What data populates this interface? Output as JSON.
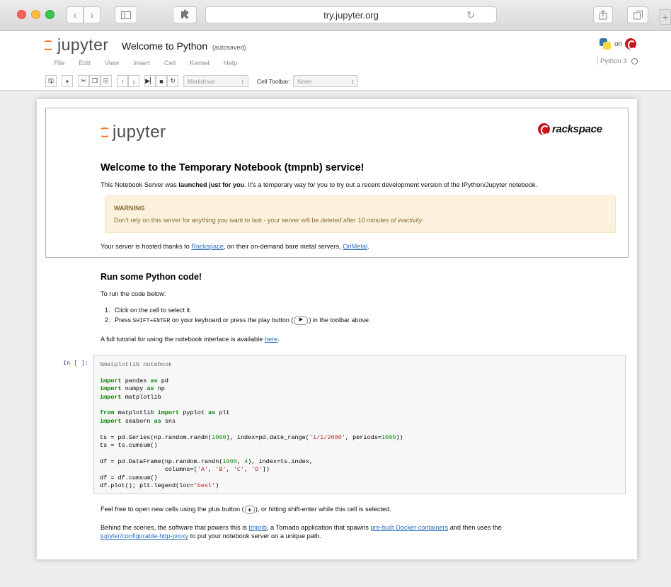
{
  "browser": {
    "url": "try.jupyter.org",
    "back_icon": "chevron-left-icon",
    "forward_icon": "chevron-right-icon",
    "sidebar_icon": "sidebar-icon",
    "extension_icon": "puzzle-icon",
    "reload_icon": "reload-icon",
    "share_icon": "share-icon",
    "tabs_icon": "tabs-icon",
    "plus_tab": "+"
  },
  "jupyter": {
    "logo_text": "jupyter",
    "notebook_title": "Welcome to Python",
    "autosave_status": "(autosaved)",
    "python_on": "on",
    "menu": [
      "File",
      "Edit",
      "View",
      "Insert",
      "Cell",
      "Kernel",
      "Help"
    ],
    "kernel_name": "Python 3",
    "toolbar": {
      "cell_type": "Markdown",
      "cell_toolbar_label": "Cell Toolbar:",
      "cell_toolbar_value": "None"
    }
  },
  "intro_cell": {
    "logo_text": "jupyter",
    "rackspace_text": "rackspace",
    "heading": "Welcome to the Temporary Notebook (tmpnb) service!",
    "p1_before": "This Notebook Server was ",
    "p1_bold": "launched just for you",
    "p1_after": ". It's a temporary way for you to try out a recent development version of the IPython/Jupyter notebook.",
    "warning_title": "WARNING",
    "warning_before": "Don't rely on this server for anything you want to last - your server will be ",
    "warning_em": "deleted after 10 minutes of inactivity",
    "warning_after": ".",
    "host_before": "Your server is hosted thanks to ",
    "host_link1": "Rackspace",
    "host_mid": ", on their on-demand bare metal servers, ",
    "host_link2": "OnMetal",
    "host_after": "."
  },
  "run_cell": {
    "heading": "Run some Python code!",
    "intro": "To run the code below:",
    "step1_num": "1.",
    "step1": "Click on the cell to select it.",
    "step2_num": "2.",
    "step2_before": "Press ",
    "step2_key": "SHIFT+ENTER",
    "step2_mid": " on your keyboard or press the play button (",
    "step2_after": ") in the toolbar above.",
    "tutorial_before": "A full tutorial for using the notebook interface is available ",
    "tutorial_link": "here",
    "tutorial_after": "."
  },
  "code_cell": {
    "prompt": "In [ ]:",
    "lines": [
      "%matplotlib notebook",
      "",
      "import pandas as pd",
      "import numpy as np",
      "import matplotlib",
      "",
      "from matplotlib import pyplot as plt",
      "import seaborn as sns",
      "",
      "ts = pd.Series(np.random.randn(1000), index=pd.date_range('1/1/2000', periods=1000))",
      "ts = ts.cumsum()",
      "",
      "df = pd.DataFrame(np.random.randn(1000, 4), index=ts.index,",
      "                  columns=['A', 'B', 'C', 'D'])",
      "df = df.cumsum()",
      "df.plot(); plt.legend(loc='best')"
    ]
  },
  "footer_cell": {
    "p1_before": "Feel free to open new cells using the plus button (",
    "p1_after": "), or hitting shift-enter while this cell is selected.",
    "p2_before": "Behind the scenes, the software that powers this is ",
    "p2_link1": "tmpnb",
    "p2_mid1": ", a Tornado application that spawns ",
    "p2_link2": "pre-built Docker containers",
    "p2_mid2": " and then uses the",
    "p2_link3": "jupyter/configurable-http-proxy",
    "p2_after": " to put your notebook server on a unique path."
  }
}
